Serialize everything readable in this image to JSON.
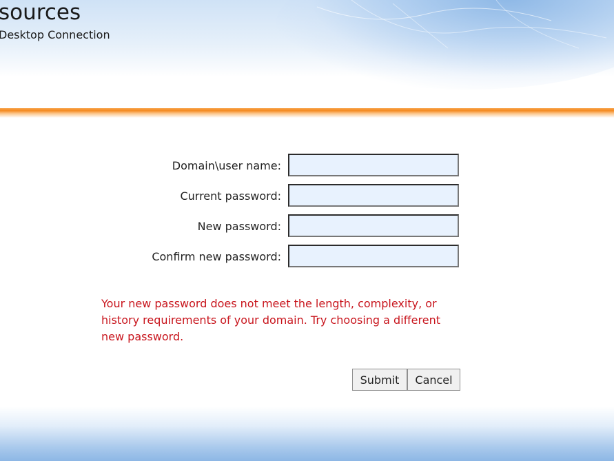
{
  "header": {
    "title": "sources",
    "subtitle": "Desktop Connection"
  },
  "form": {
    "fields": [
      {
        "label": "Domain\\user name:",
        "value": "",
        "type": "text"
      },
      {
        "label": "Current password:",
        "value": "",
        "type": "password"
      },
      {
        "label": "New password:",
        "value": "",
        "type": "password"
      },
      {
        "label": "Confirm new password:",
        "value": "",
        "type": "password"
      }
    ],
    "error_message": "Your new password does not meet the length, complexity, or history requirements of your domain. Try choosing a different new password.",
    "submit_label": "Submit",
    "cancel_label": "Cancel"
  },
  "colors": {
    "accent_orange": "#f58a1f",
    "error_red": "#c8141c",
    "input_bg": "#e8f2fe",
    "banner_blue": "#8db7e5"
  }
}
